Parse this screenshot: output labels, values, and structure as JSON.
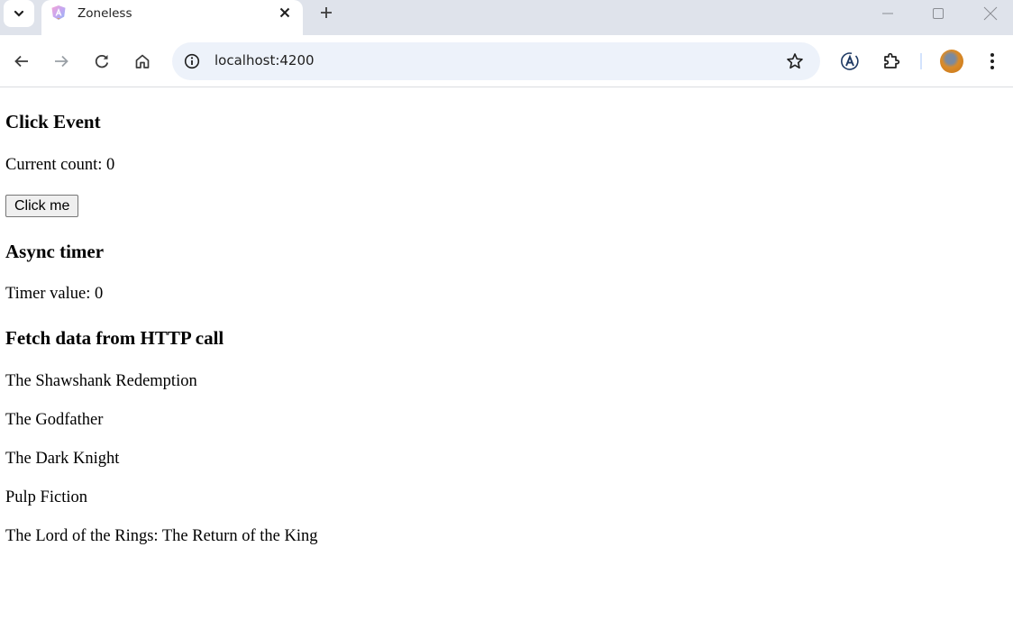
{
  "browser": {
    "tab": {
      "title": "Zoneless",
      "favicon": "angular-icon"
    },
    "address_bar": {
      "url": "localhost:4200"
    },
    "icons": {
      "tab_search": "chevron-down-icon",
      "close_tab": "close-icon",
      "new_tab": "plus-icon",
      "minimize": "minimize-icon",
      "maximize": "maximize-icon",
      "close_window": "close-icon",
      "back": "arrow-left-icon",
      "forward": "arrow-right-icon",
      "reload": "reload-icon",
      "home": "home-icon",
      "site_info": "info-icon",
      "bookmark": "star-icon",
      "extension_a": "translate-icon",
      "extensions": "puzzle-icon",
      "profile": "avatar",
      "menu": "kebab-menu-icon"
    }
  },
  "page": {
    "click_section": {
      "heading": "Click Event",
      "count_text": "Current count: 0",
      "button_label": "Click me"
    },
    "timer_section": {
      "heading": "Async timer",
      "value_text": "Timer value: 0"
    },
    "fetch_section": {
      "heading": "Fetch data from HTTP call",
      "movies": [
        "The Shawshank Redemption",
        "The Godfather",
        "The Dark Knight",
        "Pulp Fiction",
        "The Lord of the Rings: The Return of the King"
      ]
    }
  }
}
